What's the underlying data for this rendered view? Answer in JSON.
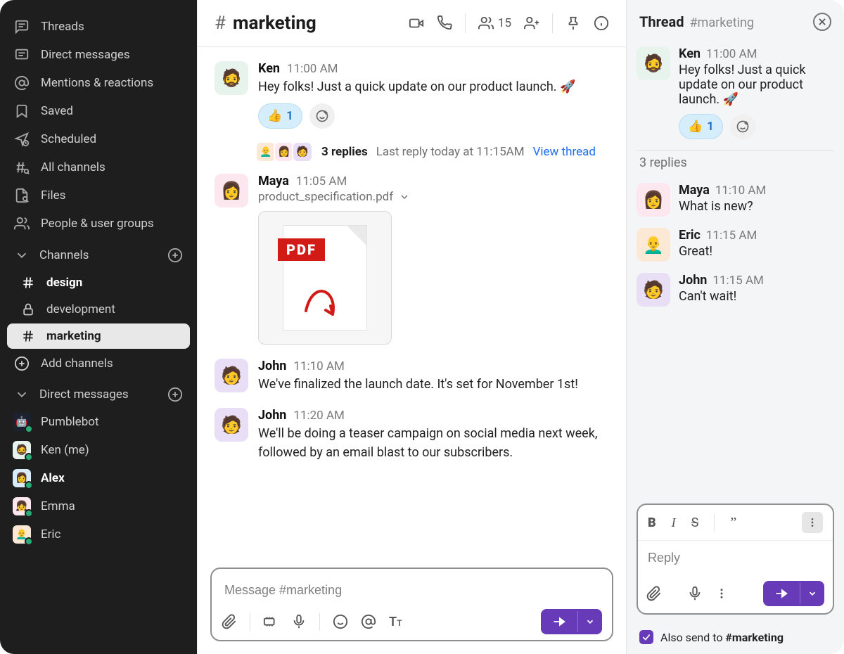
{
  "sidebar": {
    "nav": [
      {
        "label": "Threads",
        "icon": "threads"
      },
      {
        "label": "Direct messages",
        "icon": "dm"
      },
      {
        "label": "Mentions & reactions",
        "icon": "mentions"
      },
      {
        "label": "Saved",
        "icon": "saved"
      },
      {
        "label": "Scheduled",
        "icon": "scheduled"
      },
      {
        "label": "All channels",
        "icon": "allchannels"
      },
      {
        "label": "Files",
        "icon": "files"
      },
      {
        "label": "People & user groups",
        "icon": "people"
      }
    ],
    "channels_label": "Channels",
    "channels": [
      {
        "name": "design",
        "icon": "hash",
        "bold": true,
        "active": false
      },
      {
        "name": "development",
        "icon": "lock",
        "bold": false,
        "active": false
      },
      {
        "name": "marketing",
        "icon": "hash",
        "bold": true,
        "active": true
      }
    ],
    "add_channels": "Add channels",
    "dm_label": "Direct messages",
    "dms": [
      {
        "name": "Pumblebot",
        "av": "av-bot",
        "emoji": "🤖",
        "bold": false
      },
      {
        "name": "Ken (me)",
        "av": "av-ken",
        "emoji": "🧔",
        "bold": false
      },
      {
        "name": "Alex",
        "av": "av-alex",
        "emoji": "👩",
        "bold": true
      },
      {
        "name": "Emma",
        "av": "av-emma",
        "emoji": "👧",
        "bold": false
      },
      {
        "name": "Eric",
        "av": "av-eric",
        "emoji": "👨‍🦲",
        "bold": false
      }
    ]
  },
  "channel": {
    "name": "marketing",
    "members_count": "15"
  },
  "composer": {
    "placeholder": "Message #marketing"
  },
  "messages": [
    {
      "id": "m1",
      "author": "Ken",
      "time": "11:00 AM",
      "av": "av-ken",
      "emoji": "🧔",
      "text": "Hey folks! Just a quick update on our product launch. 🚀",
      "reaction": {
        "emoji": "👍",
        "count": "1"
      },
      "thread": {
        "count": "3 replies",
        "meta": "Last reply today at 11:15AM",
        "link": "View thread",
        "avatars": [
          {
            "av": "av-eric",
            "emoji": "👨‍🦲"
          },
          {
            "av": "av-maya",
            "emoji": "👩"
          },
          {
            "av": "av-john",
            "emoji": "🧑"
          }
        ]
      }
    },
    {
      "id": "m2",
      "author": "Maya",
      "time": "11:05 AM",
      "av": "av-maya",
      "emoji": "👩",
      "file": "product_specification.pdf"
    },
    {
      "id": "m3",
      "author": "John",
      "time": "11:10 AM",
      "av": "av-john",
      "emoji": "🧑",
      "text": "We've finalized the launch date. It's set for November 1st!"
    },
    {
      "id": "m4",
      "author": "John",
      "time": "11:20 AM",
      "av": "av-john",
      "emoji": "🧑",
      "text": "We'll be doing a teaser campaign on social media next week, followed by an email blast to our subscribers."
    }
  ],
  "thread": {
    "title": "Thread",
    "channel": "#marketing",
    "parent": {
      "author": "Ken",
      "time": "11:00 AM",
      "av": "av-ken",
      "emoji": "🧔",
      "text": "Hey folks! Just a quick update on our product launch. 🚀",
      "reaction": {
        "emoji": "👍",
        "count": "1"
      }
    },
    "replies_label": "3 replies",
    "replies": [
      {
        "author": "Maya",
        "time": "11:10 AM",
        "av": "av-maya",
        "emoji": "👩",
        "text": "What is new?"
      },
      {
        "author": "Eric",
        "time": "11:15 AM",
        "av": "av-eric",
        "emoji": "👨‍🦲",
        "text": "Great!"
      },
      {
        "author": "John",
        "time": "11:15 AM",
        "av": "av-john",
        "emoji": "🧑",
        "text": "Can't wait!"
      }
    ],
    "reply_placeholder": "Reply",
    "also_send_label": "Also send to ",
    "also_send_channel": "#marketing"
  }
}
